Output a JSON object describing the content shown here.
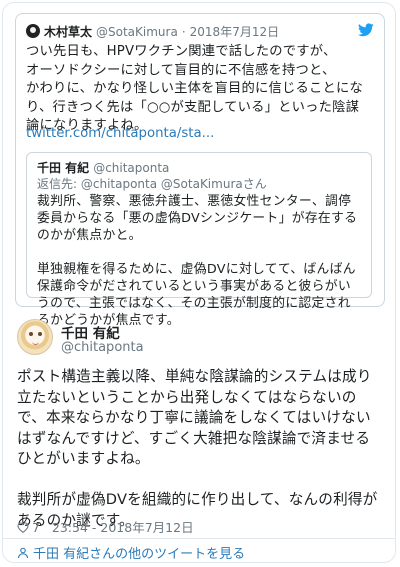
{
  "quoted_tweet": {
    "author_name": "木村草太",
    "author_handle": "@SotaKimura",
    "separator": "·",
    "date": "2018年7月12日",
    "text": "つい先日も、HPVワクチン関連で話したのですが、\nオーソドクシーに対して盲目的に不信感を持つと、\nかわりに、かなり怪しい主体を盲目的に信じることになり、行きつく先は「○○が支配している」といった陰謀論になりますよね。",
    "link": "twitter.com/chitaponta/sta...",
    "nested_quote": {
      "author_name": "千田 有紀",
      "author_handle": "@chitaponta",
      "reply_label": "返信先:",
      "reply_to_1": "@chitaponta",
      "reply_to_2": "@SotaKimuraさん",
      "text": "裁判所、警察、悪徳弁護士、悪徳女性センター、調停委員からなる「悪の虚偽DVシンジケート」が存在するのかが焦点かと。\n\n単独親権を得るために、虚偽DVに対してて、ばんばん保護命令がだされているという事実があると彼らがいうので、主張ではなく、その主張が制度的に認定されるかどうかが焦点です。"
    }
  },
  "tweet": {
    "author_name": "千田 有紀",
    "author_handle": "@chitaponta",
    "text": "ポスト構造主義以降、単純な陰謀論的システムは成り立たないということから出発しなくてはならないので、本来ならかなり丁寧に議論をしなくてはいけないはずなんですけど、すごく大雑把な陰謀論で済ませるひとがいますよね。\n\n裁判所が虚偽DVを組織的に作り出して、なんの利得があるのか謎です。",
    "likes": "7",
    "time": "23:54",
    "meta_sep": "-",
    "date": "2018年7月12日"
  },
  "footer": {
    "more_tweets": "千田 有紀さんの他のツイートを見る"
  },
  "icons": {
    "bird": "twitter-bird-icon",
    "heart": "heart-icon",
    "person": "person-icon"
  },
  "colors": {
    "link": "#2b7bb9",
    "muted": "#697882",
    "border": "#ccd6dd",
    "bird": "#1da1f2"
  }
}
